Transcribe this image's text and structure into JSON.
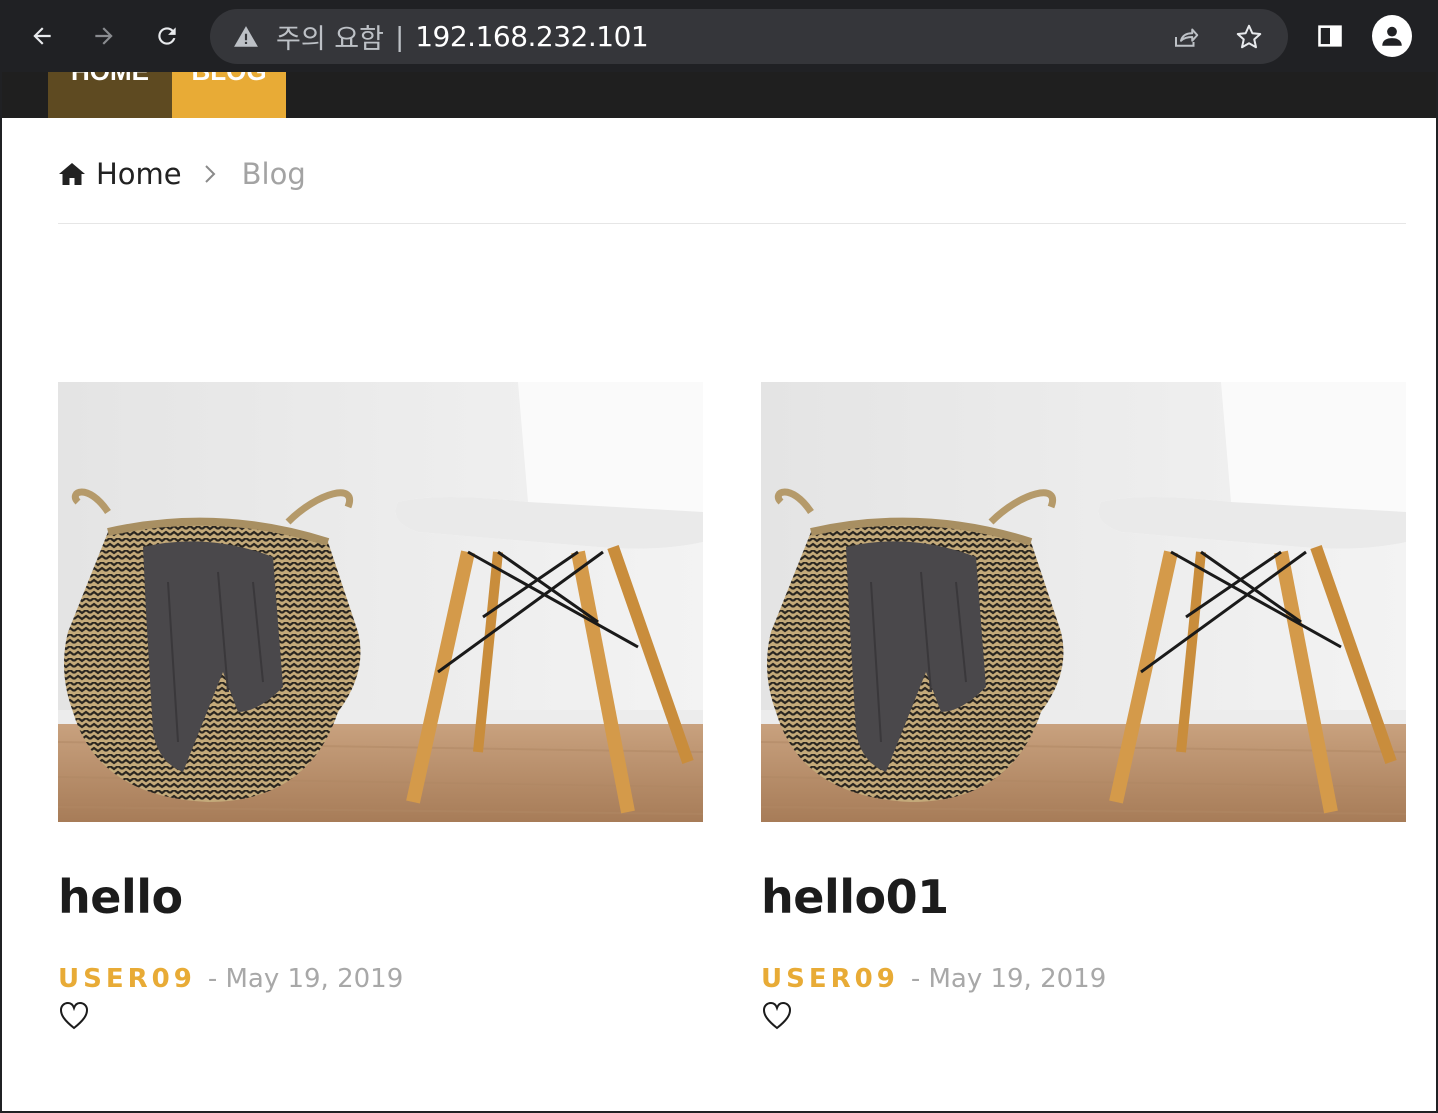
{
  "browser": {
    "security_label": "주의 요함",
    "separator": "|",
    "url": "192.168.232.101"
  },
  "site_nav": {
    "items": [
      {
        "label": "HOME"
      },
      {
        "label": "BLOG"
      }
    ]
  },
  "breadcrumb": {
    "home_label": "Home",
    "current_label": "Blog"
  },
  "posts": [
    {
      "title": "hello",
      "author": "USER09",
      "date": "- May 19, 2019",
      "like_icon": "heart-outline-icon"
    },
    {
      "title": "hello01",
      "author": "USER09",
      "date": "- May 19, 2019",
      "like_icon": "heart-outline-icon"
    }
  ],
  "colors": {
    "browser_bg": "#202124",
    "omnibox_bg": "#35363a",
    "nav_home_bg": "#5e4a21",
    "nav_blog_bg": "#e8ab36",
    "accent": "#e8ab36",
    "date_gray": "#a8a8a8"
  },
  "icons": {
    "back": "back-arrow-icon",
    "forward": "forward-arrow-icon",
    "reload": "reload-icon",
    "warning": "warning-triangle-icon",
    "share": "share-icon",
    "bookmark": "star-icon",
    "side_panel": "side-panel-icon",
    "profile": "profile-icon",
    "breadcrumb_home": "home-icon",
    "breadcrumb_separator": "chevron-right-icon"
  }
}
